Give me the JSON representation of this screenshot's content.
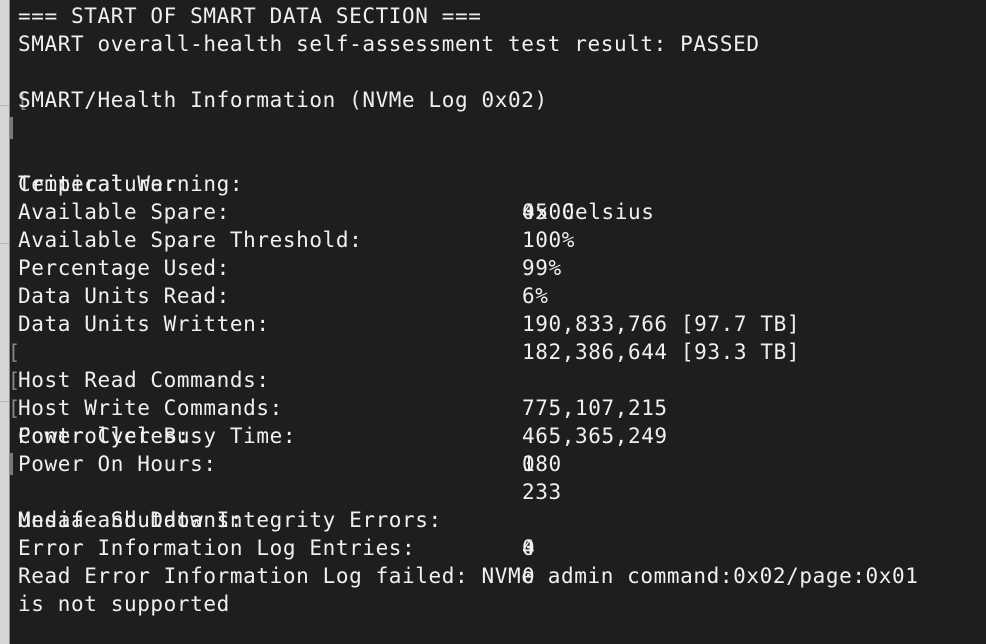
{
  "terminal": {
    "header": "=== START OF SMART DATA SECTION ===",
    "health_result": "SMART overall-health self-assessment test result: PASSED",
    "section_title": "SMART/Health Information (NVMe Log 0x02)",
    "bracket_glyph": "[",
    "attributes": [
      {
        "label": "Critical Warning:",
        "value": "0x00"
      },
      {
        "label": "Temperature:",
        "value": "45 Celsius"
      },
      {
        "label": "Available Spare:",
        "value": "100%"
      },
      {
        "label": "Available Spare Threshold:",
        "value": "99%"
      },
      {
        "label": "Percentage Used:",
        "value": "6%"
      },
      {
        "label": "Data Units Read:",
        "value": "190,833,766 [97.7 TB]"
      },
      {
        "label": "Data Units Written:",
        "value": "182,386,644 [93.3 TB]"
      },
      {
        "label": "Host Read Commands:",
        "value": "775,107,215"
      },
      {
        "label": "Host Write Commands:",
        "value": "465,365,249"
      },
      {
        "label": "Controller Busy Time:",
        "value": "0"
      },
      {
        "label": "Power Cycles:",
        "value": "180"
      },
      {
        "label": "Power On Hours:",
        "value": "233"
      },
      {
        "label": "Unsafe Shutdowns:",
        "value": "4"
      },
      {
        "label": "Media and Data Integrity Errors:",
        "value": "0"
      },
      {
        "label": "Error Information Log Entries:",
        "value": "0"
      }
    ],
    "error_line_1": "Read Error Information Log failed: NVMe admin command:0x02/page:0x01",
    "error_line_2": "is not supported"
  },
  "colors": {
    "background": "#1e1e1e",
    "text": "#f0f0f0"
  }
}
